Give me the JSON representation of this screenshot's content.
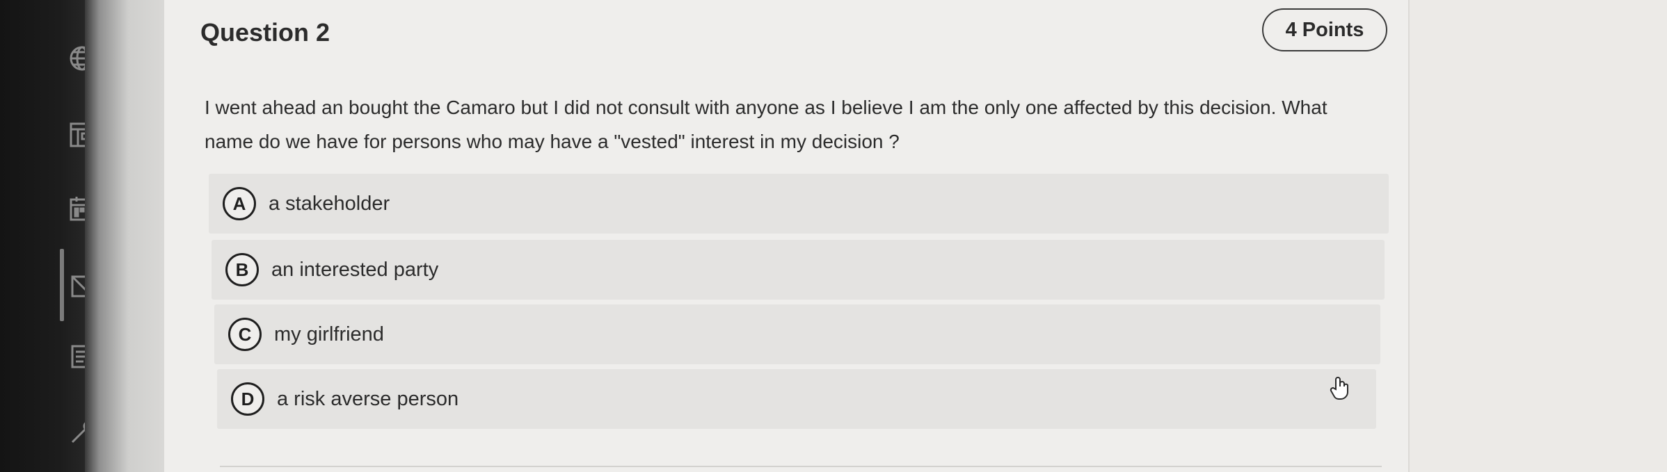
{
  "question": {
    "title": "Question 2",
    "points": "4 Points",
    "text": "I went ahead an bought the Camaro but I did not consult with anyone as I believe I am the only one affected by this decision. What name do we have for persons who may have a \"vested\" interest in my decision ?"
  },
  "options": [
    {
      "letter": "A",
      "label": "a stakeholder"
    },
    {
      "letter": "B",
      "label": "an interested party"
    },
    {
      "letter": "C",
      "label": "my girlfriend"
    },
    {
      "letter": "D",
      "label": "a risk averse person"
    }
  ],
  "rail": {
    "icons": [
      "globe-icon",
      "layout-icon",
      "calendar-icon",
      "assignment-icon",
      "document-icon",
      "settings-icon"
    ]
  },
  "colors": {
    "panel": "#efeeec",
    "option_bg": "#e4e3e1",
    "rail": "#1a1a1a"
  }
}
